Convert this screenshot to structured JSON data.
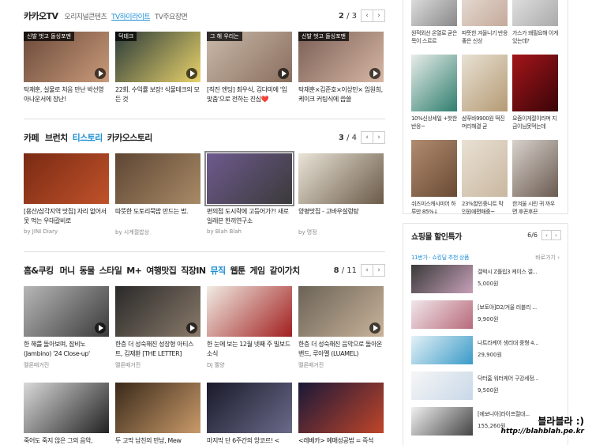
{
  "kakao_tv": {
    "tabs": [
      "카카오TV",
      "오리지널콘텐츠",
      "TV하이라이트",
      "TV주요장면"
    ],
    "active_tab": 2,
    "pager": {
      "current": "2",
      "total": "3"
    },
    "cards": [
      {
        "badge": "신발 벗고 돌싱포맨",
        "title": "탁재훈, 실물로 처음 만난 박선영 아나운서에 장난!",
        "colors": [
          "#6b4a3a",
          "#c99a7a"
        ]
      },
      {
        "badge": "덕테크",
        "title": "22회. 수익률 보장! 식물테크의 모든 것",
        "colors": [
          "#2b3b3a",
          "#e8d26a"
        ]
      },
      {
        "badge": "그 해 우리는",
        "title": "[직진 엔딩] 최우식, 김다미에 '입맞춤'으로 전하는 진심❤️",
        "colors": [
          "#c9b9a9",
          "#8a6e5e"
        ]
      },
      {
        "badge": "신발 벗고 돌싱포맨",
        "title": "탁재훈×김준호×이상민× 임원희, 케이크 커팅식에 씁쓸",
        "colors": [
          "#7a5f55",
          "#d7b7a5"
        ]
      }
    ]
  },
  "cafe": {
    "tabs": [
      "카페",
      "브런치",
      "티스토리",
      "카카오스토리"
    ],
    "active_tab": 2,
    "pager": {
      "current": "3",
      "total": "4"
    },
    "cards": [
      {
        "title": "[용산/삼각지역 맛집] 자리 없어서 못 먹는 우대갈비로",
        "by": "by JINI Diary",
        "colors": [
          "#7a2a14",
          "#c0522a"
        ]
      },
      {
        "title": "따뜻한 도토리묵밥 만드는 법.",
        "by": "by 시계절밥상",
        "colors": [
          "#5e4634",
          "#a88a66"
        ]
      },
      {
        "title": "편의점 도시락에 고등어가?! 새로 일레븐 한끼연구소",
        "by": "by Blah Blah",
        "colors": [
          "#6e5a8e",
          "#3a3a3a"
        ]
      },
      {
        "title": "양평맛집 - 고바우설렁탕",
        "by": "by 명정",
        "colors": [
          "#e9e4d7",
          "#6b5a48"
        ]
      }
    ]
  },
  "home": {
    "tabs": [
      "홈&쿠킹",
      "머니",
      "동물",
      "스타일",
      "M+",
      "여행맛집",
      "직장IN",
      "뮤직",
      "웹툰",
      "게임",
      "같이가치"
    ],
    "active_tab": 7,
    "pager": {
      "current": "8",
      "total": "11"
    },
    "cards": [
      {
        "title": "한 해를 돌아보며, 잠비노(Jambino) '24 Close-up'",
        "by": "멜론매거진",
        "colors": [
          "#b7b7b7",
          "#3a3a3a"
        ]
      },
      {
        "title": "한층 더 성숙해진 성장형 아티스트, 김재환 [THE LETTER]",
        "by": "멜론매거진",
        "colors": [
          "#2a2a2a",
          "#8a7a6a"
        ]
      },
      {
        "title": "한 눈에 보는 12월 넷째 주 빌보드 소식",
        "by": "DJ 멜양",
        "colors": [
          "#f1ece4",
          "#a11f1f"
        ]
      },
      {
        "title": "한층 더 성숙해진 음악으로 돌아온 밴드, 루아멜 (LUAMEL)",
        "by": "멜론매거진",
        "colors": [
          "#6b6357",
          "#c9b39a"
        ]
      },
      {
        "title": "죽어도 죽지 않은 그의 음악,",
        "by": "",
        "colors": [
          "#d9d9d9",
          "#222222"
        ]
      },
      {
        "title": "두 고막 남친의 만남, Mew",
        "by": "",
        "colors": [
          "#3a2a1a",
          "#c99a6a"
        ]
      },
      {
        "title": "마지막 단 6주간의 앙코르! <",
        "by": "",
        "colors": [
          "#1a1a2a",
          "#6a6a8a"
        ]
      },
      {
        "title": "<레베카> 예매성공법 = 즉석",
        "by": "",
        "colors": [
          "#1a1838",
          "#c0452a"
        ]
      }
    ]
  },
  "side_products": [
    {
      "title": "원적외선 온열로 굳은목이 스르르",
      "colors": [
        "#ffffff",
        "#888888"
      ]
    },
    {
      "title": "따뜻한 겨울니기 반응좋은 신상",
      "colors": [
        "#f2ece7",
        "#c4a99a"
      ]
    },
    {
      "title": "가스가 왜필요해 이게 있는데?",
      "colors": [
        "#f4f4f4",
        "#aaaaaa"
      ]
    },
    {
      "title": "10%신상세일 +핫한반응~",
      "colors": [
        "#e8ece8",
        "#2f7f6f"
      ]
    },
    {
      "title": "샴푸바9900원 떡진머리해결 굳",
      "colors": [
        "#e8e1d4",
        "#b59a74"
      ]
    },
    {
      "title": "요즘이게절이라며 지금이님못먹는데",
      "colors": [
        "#a3151a",
        "#3a0508"
      ]
    },
    {
      "title": "쉬즈미스캐시미어 하루만 85%↓",
      "colors": [
        "#b08c70",
        "#6a4a34"
      ]
    },
    {
      "title": "23%할인중니트 막인원에편매중~",
      "colors": [
        "#e9e1d4",
        "#c9b7a0"
      ]
    },
    {
      "title": "한겨울 시린 귀 까우면 후끈후끈",
      "colors": [
        "#d8d2cc",
        "#6a5a50"
      ]
    }
  ],
  "shopping": {
    "title": "쇼핑몰 할인특가",
    "pager": {
      "current": "6",
      "total": "6"
    },
    "subtitle": "11번가 · 쇼킹딜 추천 상품",
    "more": "바로가기 ›",
    "items": [
      {
        "name": "갤럭시 Z플립3 케이스 갤...",
        "price": "5,000원",
        "colors": [
          "#3a3a3a",
          "#c6a0b8"
        ]
      },
      {
        "name": "[보토야]D2/겨울 러블리 ...",
        "price": "9,900원",
        "colors": [
          "#f0e6ea",
          "#b86a7a"
        ]
      },
      {
        "name": "나트라케어 생리대 중형 4...",
        "price": "29,900원",
        "colors": [
          "#e4f1f6",
          "#3a9ac8"
        ]
      },
      {
        "name": "닥터홈 워터케어 구강세정...",
        "price": "9,500원",
        "colors": [
          "#f6f6f6",
          "#c8d8e8"
        ]
      },
      {
        "name": "[에보니아]라이프절대...",
        "price": "155,260원",
        "colors": [
          "#f0f0f0",
          "#444444"
        ]
      }
    ]
  },
  "watermark": {
    "name": "블라블라 :)",
    "url": "http://blahblah.pe.kr"
  },
  "icons": {
    "prev": "‹",
    "next": "›"
  }
}
